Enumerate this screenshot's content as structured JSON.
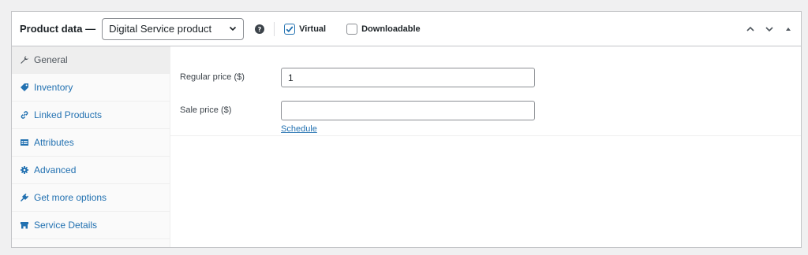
{
  "header": {
    "title": "Product data —",
    "product_type": "Digital Service product",
    "help_icon": "question-circle-icon",
    "virtual_label": "Virtual",
    "virtual_checked": true,
    "downloadable_label": "Downloadable",
    "downloadable_checked": false
  },
  "sidebar": {
    "tabs": [
      {
        "label": "General",
        "icon": "wrench-icon",
        "active": true
      },
      {
        "label": "Inventory",
        "icon": "tag-icon",
        "active": false
      },
      {
        "label": "Linked Products",
        "icon": "link-icon",
        "active": false
      },
      {
        "label": "Attributes",
        "icon": "list-table-icon",
        "active": false
      },
      {
        "label": "Advanced",
        "icon": "gear-icon",
        "active": false
      },
      {
        "label": "Get more options",
        "icon": "plugin-icon",
        "active": false
      },
      {
        "label": "Service Details",
        "icon": "store-icon",
        "active": false
      }
    ]
  },
  "general": {
    "regular_price_label": "Regular price ($)",
    "regular_price_value": "1",
    "sale_price_label": "Sale price ($)",
    "sale_price_value": "",
    "schedule_link": "Schedule"
  },
  "colors": {
    "accent": "#2271b1",
    "border": "#c3c4c7",
    "page_bg": "#f0f0f1",
    "sidebar_bg": "#fafafa",
    "active_tab_bg": "#eeeeee"
  }
}
